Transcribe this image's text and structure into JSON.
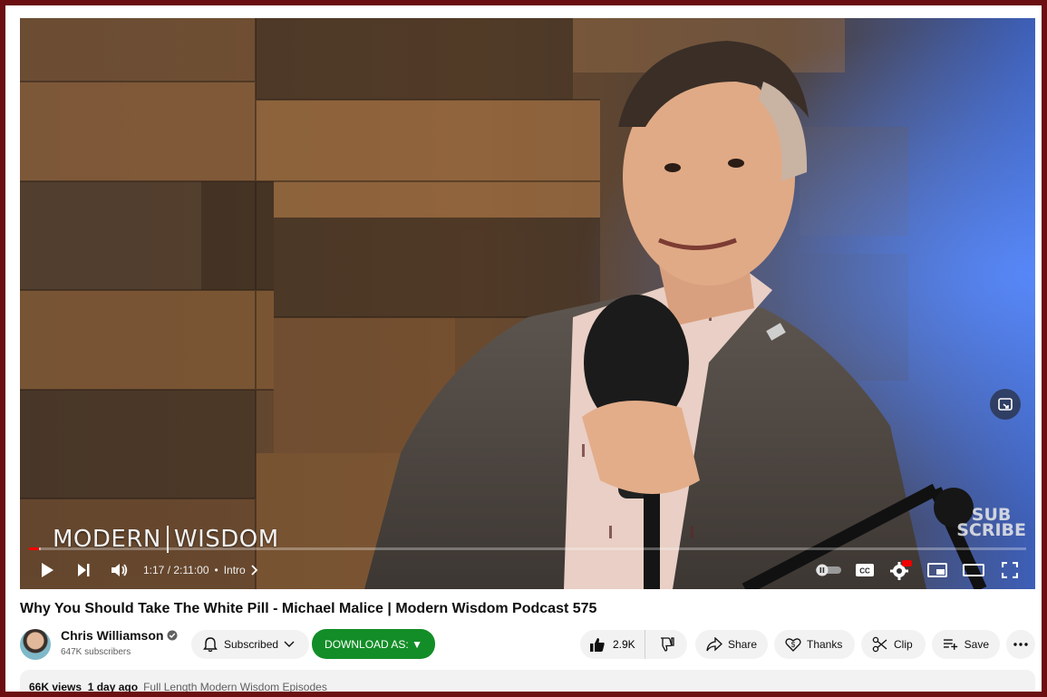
{
  "video": {
    "brand_left": "MODERN",
    "brand_right": "WISDOM",
    "watermark_top": "SUB",
    "watermark_bottom": "SCRIBE",
    "progress": {
      "played_fraction": 0.0097,
      "loaded_fraction": 0.012
    },
    "controls": {
      "time": "1:17 / 2:11:00",
      "chapter_separator": "•",
      "chapter": "Intro"
    }
  },
  "title": "Why You Should Take The White Pill - Michael Malice | Modern Wisdom Podcast 575",
  "channel": {
    "name": "Chris Williamson",
    "subscribers": "647K subscribers",
    "subscribed_label": "Subscribed"
  },
  "download_label": "DOWNLOAD AS: ▼",
  "actions": {
    "likes": "2.9K",
    "share": "Share",
    "thanks": "Thanks",
    "clip": "Clip",
    "save": "Save"
  },
  "description": {
    "views_date": "66K views  1 day ago",
    "tags": "Full Length Modern Wisdom Episodes"
  },
  "colors": {
    "frame": "#6b0f12",
    "progress_played": "#ff0000",
    "download_button": "#138d27"
  }
}
